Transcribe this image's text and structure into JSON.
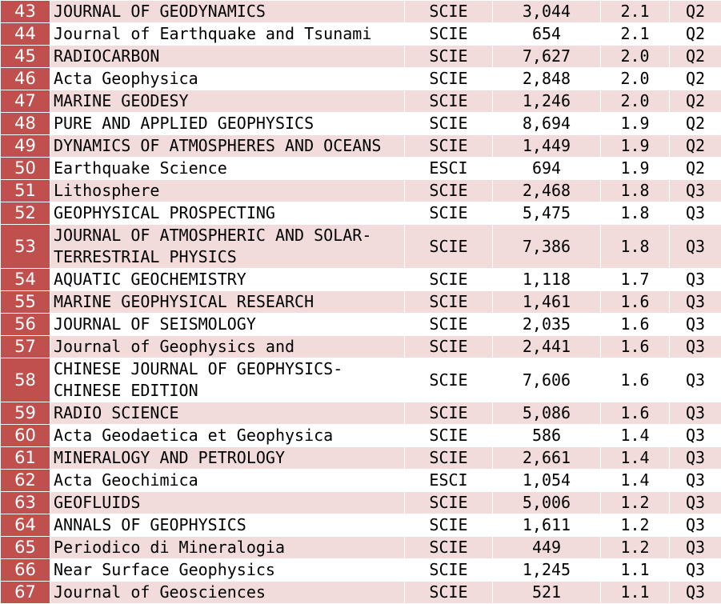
{
  "table": {
    "rows": [
      {
        "rank": "43",
        "journal": "JOURNAL OF GEODYNAMICS",
        "index": "SCIE",
        "citations": "3,044",
        "impact_factor": "2.1",
        "quartile": "Q2"
      },
      {
        "rank": "44",
        "journal": "Journal of Earthquake and Tsunami",
        "index": "SCIE",
        "citations": "654",
        "impact_factor": "2.1",
        "quartile": "Q2"
      },
      {
        "rank": "45",
        "journal": "RADIOCARBON",
        "index": "SCIE",
        "citations": "7,627",
        "impact_factor": "2.0",
        "quartile": "Q2"
      },
      {
        "rank": "46",
        "journal": "Acta Geophysica",
        "index": "SCIE",
        "citations": "2,848",
        "impact_factor": "2.0",
        "quartile": "Q2"
      },
      {
        "rank": "47",
        "journal": "MARINE GEODESY",
        "index": "SCIE",
        "citations": "1,246",
        "impact_factor": "2.0",
        "quartile": "Q2"
      },
      {
        "rank": "48",
        "journal": "PURE AND APPLIED GEOPHYSICS",
        "index": "SCIE",
        "citations": "8,694",
        "impact_factor": "1.9",
        "quartile": "Q2"
      },
      {
        "rank": "49",
        "journal": "DYNAMICS OF ATMOSPHERES AND OCEANS",
        "index": "SCIE",
        "citations": "1,449",
        "impact_factor": "1.9",
        "quartile": "Q2"
      },
      {
        "rank": "50",
        "journal": "Earthquake Science",
        "index": "ESCI",
        "citations": "694",
        "impact_factor": "1.9",
        "quartile": "Q2"
      },
      {
        "rank": "51",
        "journal": "Lithosphere",
        "index": "SCIE",
        "citations": "2,468",
        "impact_factor": "1.8",
        "quartile": "Q3"
      },
      {
        "rank": "52",
        "journal": "GEOPHYSICAL PROSPECTING",
        "index": "SCIE",
        "citations": "5,475",
        "impact_factor": "1.8",
        "quartile": "Q3"
      },
      {
        "rank": "53",
        "journal": "JOURNAL OF ATMOSPHERIC AND SOLAR-TERRESTRIAL PHYSICS",
        "journal_lines": [
          "JOURNAL OF ATMOSPHERIC AND SOLAR-",
          "TERRESTRIAL PHYSICS"
        ],
        "index": "SCIE",
        "citations": "7,386",
        "impact_factor": "1.8",
        "quartile": "Q3"
      },
      {
        "rank": "54",
        "journal": "AQUATIC GEOCHEMISTRY",
        "index": "SCIE",
        "citations": "1,118",
        "impact_factor": "1.7",
        "quartile": "Q3"
      },
      {
        "rank": "55",
        "journal": "MARINE GEOPHYSICAL RESEARCH",
        "index": "SCIE",
        "citations": "1,461",
        "impact_factor": "1.6",
        "quartile": "Q3"
      },
      {
        "rank": "56",
        "journal": "JOURNAL OF SEISMOLOGY",
        "index": "SCIE",
        "citations": "2,035",
        "impact_factor": "1.6",
        "quartile": "Q3"
      },
      {
        "rank": "57",
        "journal": "Journal of Geophysics and",
        "index": "SCIE",
        "citations": "2,441",
        "impact_factor": "1.6",
        "quartile": "Q3"
      },
      {
        "rank": "58",
        "journal": "CHINESE JOURNAL OF GEOPHYSICS-CHINESE EDITION",
        "journal_lines": [
          "CHINESE JOURNAL OF GEOPHYSICS-",
          "CHINESE EDITION"
        ],
        "index": "SCIE",
        "citations": "7,606",
        "impact_factor": "1.6",
        "quartile": "Q3"
      },
      {
        "rank": "59",
        "journal": "RADIO SCIENCE",
        "index": "SCIE",
        "citations": "5,086",
        "impact_factor": "1.6",
        "quartile": "Q3"
      },
      {
        "rank": "60",
        "journal": "Acta Geodaetica et Geophysica",
        "index": "SCIE",
        "citations": "586",
        "impact_factor": "1.4",
        "quartile": "Q3"
      },
      {
        "rank": "61",
        "journal": "MINERALOGY AND PETROLOGY",
        "index": "SCIE",
        "citations": "2,661",
        "impact_factor": "1.4",
        "quartile": "Q3"
      },
      {
        "rank": "62",
        "journal": "Acta Geochimica",
        "index": "ESCI",
        "citations": "1,054",
        "impact_factor": "1.4",
        "quartile": "Q3"
      },
      {
        "rank": "63",
        "journal": "GEOFLUIDS",
        "index": "SCIE",
        "citations": "5,006",
        "impact_factor": "1.2",
        "quartile": "Q3"
      },
      {
        "rank": "64",
        "journal": "ANNALS OF GEOPHYSICS",
        "index": "SCIE",
        "citations": "1,611",
        "impact_factor": "1.2",
        "quartile": "Q3"
      },
      {
        "rank": "65",
        "journal": "Periodico di Mineralogia",
        "index": "SCIE",
        "citations": "449",
        "impact_factor": "1.2",
        "quartile": "Q3"
      },
      {
        "rank": "66",
        "journal": "Near Surface Geophysics",
        "index": "SCIE",
        "citations": "1,245",
        "impact_factor": "1.1",
        "quartile": "Q3"
      },
      {
        "rank": "67",
        "journal": "Journal of Geosciences",
        "index": "SCIE",
        "citations": "521",
        "impact_factor": "1.1",
        "quartile": "Q3"
      }
    ]
  },
  "colors": {
    "rank_cell_bg": "#c0504d",
    "band_pink": "#f2dcdb",
    "band_white": "#ffffff"
  }
}
